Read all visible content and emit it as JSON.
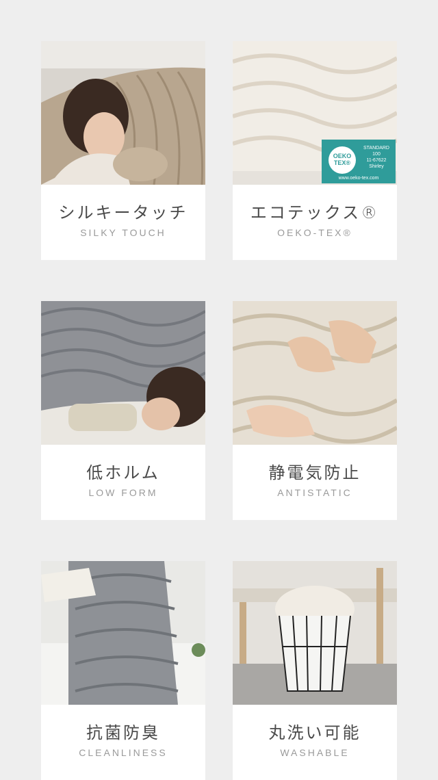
{
  "features": [
    {
      "jp": "シルキータッチ",
      "en": "SILKY TOUCH",
      "image": "woman-sleeping-on-beige-blanket"
    },
    {
      "jp": "エコテックス®",
      "en": "OEKO-TEX®",
      "image": "cream-blanket-with-oeko-tex-label"
    },
    {
      "jp": "低ホルム",
      "en": "LOW FORM",
      "image": "woman-under-gray-blanket"
    },
    {
      "jp": "静電気防止",
      "en": "ANTISTATIC",
      "image": "hands-and-feet-on-beige-blanket"
    },
    {
      "jp": "抗菌防臭",
      "en": "CLEANLINESS",
      "image": "gray-blanket-on-bed"
    },
    {
      "jp": "丸洗い可能",
      "en": "WASHABLE",
      "image": "blanket-in-wire-basket"
    }
  ],
  "oeko_badge": {
    "logo_line1": "OEKO",
    "logo_line2": "TEX®",
    "standard": "STANDARD",
    "number": "100",
    "code": "11-67622",
    "lab": "Shirley",
    "url": "www.oeko-tex.com"
  },
  "colors": {
    "background": "#eeeeee",
    "card": "#ffffff",
    "title": "#4a4a4a",
    "subtitle": "#9a9a9a",
    "oeko": "#2f9c9a"
  }
}
